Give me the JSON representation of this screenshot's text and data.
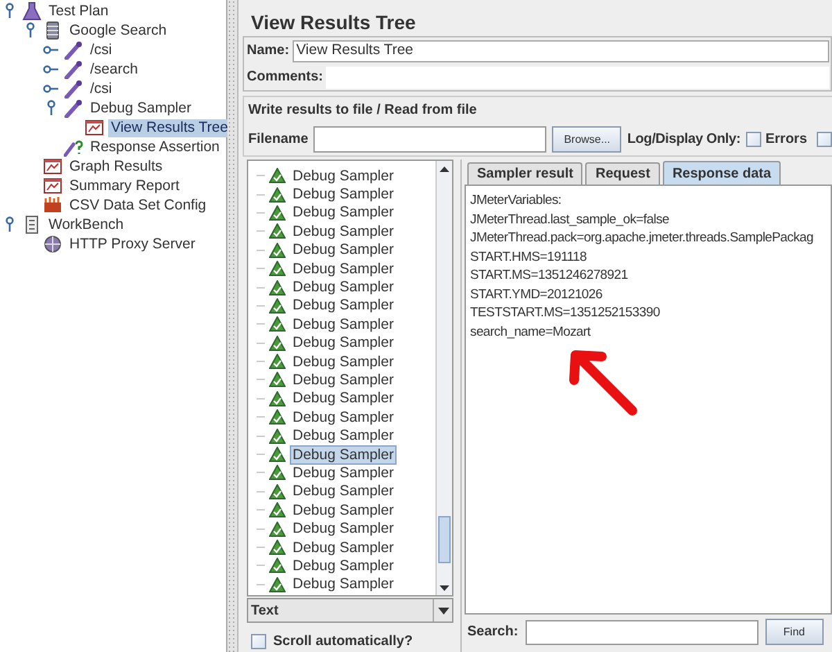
{
  "tree": [
    {
      "label": "Test Plan",
      "kind": "plan",
      "expanded": true,
      "selected": false,
      "children": [
        {
          "label": "Google Search",
          "kind": "thread_group",
          "expanded": true,
          "selected": false,
          "children": [
            {
              "label": "/csi",
              "kind": "sampler",
              "expanded": false,
              "selected": false
            },
            {
              "label": "/search",
              "kind": "sampler",
              "expanded": false,
              "selected": false
            },
            {
              "label": "/csi",
              "kind": "sampler",
              "expanded": false,
              "selected": false
            },
            {
              "label": "Debug Sampler",
              "kind": "sampler",
              "expanded": true,
              "selected": false,
              "children": [
                {
                  "label": "View Results Tree",
                  "kind": "listener",
                  "selected": true
                }
              ]
            },
            {
              "label": "Response Assertion",
              "kind": "assertion",
              "selected": false
            }
          ]
        },
        {
          "label": "Graph Results",
          "kind": "listener",
          "selected": false
        },
        {
          "label": "Summary Report",
          "kind": "listener",
          "selected": false
        },
        {
          "label": "CSV Data Set Config",
          "kind": "config",
          "selected": false
        }
      ]
    },
    {
      "label": "WorkBench",
      "kind": "workbench",
      "expanded": true,
      "selected": false,
      "children": [
        {
          "label": "HTTP Proxy Server",
          "kind": "proxy",
          "selected": false
        }
      ]
    }
  ],
  "panel": {
    "title": "View Results Tree",
    "name_label": "Name:",
    "name_value": "View Results Tree",
    "comments_label": "Comments:",
    "file_group": {
      "title": "Write results to file / Read from file",
      "filename_label": "Filename",
      "browse_button": "Browse...",
      "log_label": "Log/Display Only:",
      "checkboxes": [
        {
          "label": "Errors",
          "checked": false
        },
        {
          "checked": false
        }
      ]
    }
  },
  "results": [
    {
      "label": "Debug Sampler",
      "selected": false
    },
    {
      "label": "Debug Sampler",
      "selected": false
    },
    {
      "label": "Debug Sampler",
      "selected": false
    },
    {
      "label": "Debug Sampler",
      "selected": false
    },
    {
      "label": "Debug Sampler",
      "selected": false
    },
    {
      "label": "Debug Sampler",
      "selected": false
    },
    {
      "label": "Debug Sampler",
      "selected": false
    },
    {
      "label": "Debug Sampler",
      "selected": false
    },
    {
      "label": "Debug Sampler",
      "selected": false
    },
    {
      "label": "Debug Sampler",
      "selected": false
    },
    {
      "label": "Debug Sampler",
      "selected": false
    },
    {
      "label": "Debug Sampler",
      "selected": false
    },
    {
      "label": "Debug Sampler",
      "selected": false
    },
    {
      "label": "Debug Sampler",
      "selected": false
    },
    {
      "label": "Debug Sampler",
      "selected": false
    },
    {
      "label": "Debug Sampler",
      "selected": true
    },
    {
      "label": "Debug Sampler",
      "selected": false
    },
    {
      "label": "Debug Sampler",
      "selected": false
    },
    {
      "label": "Debug Sampler",
      "selected": false
    },
    {
      "label": "Debug Sampler",
      "selected": false
    },
    {
      "label": "Debug Sampler",
      "selected": false
    },
    {
      "label": "Debug Sampler",
      "selected": false
    },
    {
      "label": "Debug Sampler",
      "selected": false
    }
  ],
  "render_select": {
    "value": "Text"
  },
  "scroll_auto": {
    "label": "Scroll automatically?",
    "checked": false
  },
  "tabs": [
    {
      "label": "Sampler result",
      "selected": false
    },
    {
      "label": "Request",
      "selected": false
    },
    {
      "label": "Response data",
      "selected": true
    }
  ],
  "response_lines": [
    "JMeterVariables:",
    "JMeterThread.last_sample_ok=false",
    "JMeterThread.pack=org.apache.jmeter.threads.SamplePackag",
    "START.HMS=191118",
    "START.MS=1351246278921",
    "START.YMD=20121026",
    "TESTSTART.MS=1351252153390",
    "search_name=Mozart"
  ],
  "search": {
    "label": "Search:",
    "button": "Find"
  }
}
